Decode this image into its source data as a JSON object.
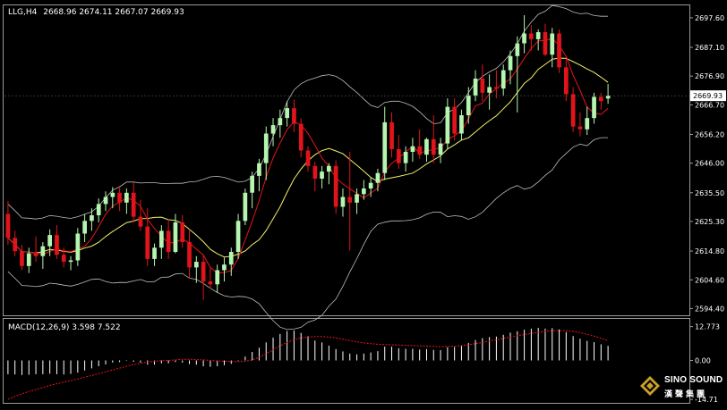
{
  "header": {
    "symbol": "LLG,H4",
    "ohlc": "2668.96 2674.11 2667.07 2669.93"
  },
  "price_axis": {
    "ticks": [
      2697.6,
      2687.1,
      2676.9,
      2666.7,
      2656.2,
      2646.0,
      2635.5,
      2625.3,
      2614.8,
      2604.6,
      2594.4
    ],
    "tick_labels": [
      "2697.60",
      "2687.10",
      "2676.90",
      "2666.70",
      "2656.20",
      "2646.00",
      "2635.50",
      "2625.30",
      "2614.80",
      "2604.60",
      "2594.40"
    ],
    "current_price": "2669.93"
  },
  "macd_panel": {
    "label": "MACD(12,26,9) 3.598 7.522",
    "tick_labels": [
      "12.773",
      "0.00",
      "-14.71"
    ],
    "ticks": [
      12.773,
      0,
      -14.71
    ]
  },
  "logo": {
    "brand": "SINO SOUND",
    "chinese": "漢聲集團"
  },
  "colors": {
    "background": "#000000",
    "bull_candle": "#b5f5b0",
    "bear_candle": "#e0141a",
    "ma_fast": "#e8141a",
    "ma_slow": "#f2ef6a",
    "bollinger": "#bdbdbd",
    "macd_hist": "#ffffff",
    "macd_signal": "#e8141a",
    "axis_text": "#ffffff"
  },
  "chart_data": {
    "type": "candlestick",
    "timeframe": "H4",
    "ylim": [
      2592.0,
      2702.0
    ],
    "candles": [
      [
        2628.0,
        2632.5,
        2617.0,
        2619.5
      ],
      [
        2619.5,
        2622.0,
        2613.0,
        2614.8
      ],
      [
        2614.8,
        2617.0,
        2608.0,
        2609.5
      ],
      [
        2609.5,
        2616.0,
        2607.0,
        2614.0
      ],
      [
        2614.0,
        2620.0,
        2611.0,
        2613.0
      ],
      [
        2613.0,
        2618.0,
        2608.5,
        2616.5
      ],
      [
        2616.5,
        2622.5,
        2613.0,
        2620.5
      ],
      [
        2620.5,
        2624.0,
        2612.0,
        2613.5
      ],
      [
        2613.5,
        2616.0,
        2609.0,
        2611.0
      ],
      [
        2611.0,
        2613.0,
        2608.0,
        2611.5
      ],
      [
        2611.5,
        2623.0,
        2609.5,
        2621.0
      ],
      [
        2621.0,
        2628.0,
        2618.0,
        2625.5
      ],
      [
        2625.5,
        2630.0,
        2622.0,
        2627.5
      ],
      [
        2627.5,
        2633.5,
        2625.0,
        2631.5
      ],
      [
        2631.5,
        2636.0,
        2629.0,
        2634.0
      ],
      [
        2634.0,
        2637.5,
        2630.0,
        2635.5
      ],
      [
        2635.5,
        2638.0,
        2629.0,
        2632.0
      ],
      [
        2632.0,
        2637.0,
        2628.0,
        2635.5
      ],
      [
        2635.5,
        2639.0,
        2625.0,
        2627.0
      ],
      [
        2627.0,
        2633.0,
        2622.0,
        2623.5
      ],
      [
        2623.5,
        2630.0,
        2609.5,
        2612.0
      ],
      [
        2612.0,
        2617.5,
        2609.5,
        2616.0
      ],
      [
        2616.0,
        2624.0,
        2612.0,
        2622.0
      ],
      [
        2622.0,
        2626.0,
        2612.0,
        2614.5
      ],
      [
        2614.5,
        2628.0,
        2614.0,
        2625.0
      ],
      [
        2625.0,
        2627.5,
        2616.0,
        2618.0
      ],
      [
        2618.0,
        2622.5,
        2605.0,
        2609.0
      ],
      [
        2609.0,
        2613.0,
        2603.5,
        2611.0
      ],
      [
        2611.0,
        2613.5,
        2597.5,
        2604.0
      ],
      [
        2604.0,
        2609.0,
        2601.5,
        2603.0
      ],
      [
        2603.0,
        2610.0,
        2600.0,
        2608.0
      ],
      [
        2608.0,
        2612.5,
        2604.0,
        2610.0
      ],
      [
        2610.0,
        2616.0,
        2606.0,
        2614.5
      ],
      [
        2614.5,
        2628.0,
        2612.0,
        2625.5
      ],
      [
        2625.5,
        2637.0,
        2624.0,
        2635.5
      ],
      [
        2635.5,
        2643.0,
        2630.0,
        2641.5
      ],
      [
        2641.5,
        2647.5,
        2636.0,
        2646.0
      ],
      [
        2646.0,
        2659.0,
        2640.0,
        2656.5
      ],
      [
        2656.5,
        2662.0,
        2652.0,
        2659.5
      ],
      [
        2659.5,
        2665.0,
        2655.0,
        2662.0
      ],
      [
        2662.0,
        2668.0,
        2659.0,
        2665.5
      ],
      [
        2665.5,
        2668.5,
        2657.0,
        2660.0
      ],
      [
        2660.0,
        2662.0,
        2648.0,
        2650.5
      ],
      [
        2650.5,
        2652.0,
        2643.0,
        2645.0
      ],
      [
        2645.0,
        2646.5,
        2636.0,
        2640.5
      ],
      [
        2640.5,
        2645.0,
        2637.0,
        2643.0
      ],
      [
        2643.0,
        2646.0,
        2638.5,
        2645.0
      ],
      [
        2645.0,
        2647.0,
        2628.0,
        2630.5
      ],
      [
        2630.5,
        2637.0,
        2627.0,
        2634.0
      ],
      [
        2634.0,
        2650.0,
        2615.0,
        2632.0
      ],
      [
        2632.0,
        2637.0,
        2628.0,
        2635.0
      ],
      [
        2635.0,
        2640.0,
        2633.0,
        2637.0
      ],
      [
        2637.0,
        2641.0,
        2634.0,
        2639.0
      ],
      [
        2639.0,
        2644.0,
        2636.0,
        2642.5
      ],
      [
        2642.5,
        2666.0,
        2640.0,
        2660.5
      ],
      [
        2660.5,
        2664.0,
        2648.0,
        2651.0
      ],
      [
        2651.0,
        2656.0,
        2644.0,
        2646.0
      ],
      [
        2646.0,
        2652.0,
        2643.0,
        2650.0
      ],
      [
        2650.0,
        2655.0,
        2646.5,
        2652.0
      ],
      [
        2652.0,
        2658.0,
        2647.5,
        2649.0
      ],
      [
        2649.0,
        2655.0,
        2646.5,
        2654.5
      ],
      [
        2654.5,
        2663.0,
        2646.0,
        2649.0
      ],
      [
        2649.0,
        2655.0,
        2646.0,
        2653.0
      ],
      [
        2653.0,
        2669.0,
        2651.0,
        2666.0
      ],
      [
        2666.0,
        2669.0,
        2654.0,
        2656.5
      ],
      [
        2656.5,
        2665.0,
        2654.0,
        2663.0
      ],
      [
        2663.0,
        2673.0,
        2660.0,
        2670.0
      ],
      [
        2670.0,
        2679.0,
        2668.0,
        2676.0
      ],
      [
        2676.0,
        2681.0,
        2668.0,
        2671.0
      ],
      [
        2671.0,
        2677.5,
        2665.0,
        2673.0
      ],
      [
        2673.0,
        2679.0,
        2669.0,
        2672.5
      ],
      [
        2672.5,
        2681.0,
        2670.0,
        2679.0
      ],
      [
        2679.0,
        2686.0,
        2674.0,
        2684.0
      ],
      [
        2684.0,
        2691.0,
        2664.0,
        2688.5
      ],
      [
        2688.5,
        2698.5,
        2685.0,
        2692.0
      ],
      [
        2692.0,
        2695.0,
        2686.0,
        2690.0
      ],
      [
        2690.0,
        2693.5,
        2686.0,
        2692.5
      ],
      [
        2692.5,
        2695.5,
        2684.0,
        2684.5
      ],
      [
        2684.5,
        2694.0,
        2680.0,
        2692.0
      ],
      [
        2692.0,
        2693.5,
        2678.0,
        2680.0
      ],
      [
        2680.0,
        2683.0,
        2668.0,
        2670.5
      ],
      [
        2670.5,
        2673.0,
        2657.0,
        2659.0
      ],
      [
        2659.0,
        2664.0,
        2655.5,
        2658.0
      ],
      [
        2658.0,
        2666.0,
        2656.0,
        2662.0
      ],
      [
        2662.0,
        2671.0,
        2660.0,
        2669.5
      ],
      [
        2669.5,
        2671.0,
        2665.0,
        2668.0
      ],
      [
        2668.96,
        2674.11,
        2667.07,
        2669.93
      ]
    ],
    "macd_histogram": [
      -5.2,
      -5.3,
      -5.5,
      -5.4,
      -5.2,
      -5.2,
      -5.0,
      -5.2,
      -5.3,
      -5.1,
      -4.6,
      -3.8,
      -3.0,
      -2.2,
      -1.5,
      -0.8,
      -0.6,
      -0.2,
      -0.5,
      -0.8,
      -1.6,
      -1.6,
      -1.1,
      -1.1,
      -0.6,
      -0.8,
      -1.4,
      -1.6,
      -2.2,
      -2.4,
      -2.2,
      -1.8,
      -1.3,
      -0.2,
      1.5,
      3.2,
      4.8,
      6.8,
      8.6,
      10.0,
      11.1,
      11.3,
      10.4,
      9.2,
      7.5,
      6.8,
      5.6,
      4.3,
      3.4,
      2.6,
      2.3,
      2.6,
      3.0,
      3.5,
      5.2,
      5.2,
      4.6,
      4.4,
      4.4,
      4.1,
      4.3,
      4.0,
      3.9,
      5.0,
      5.1,
      5.6,
      6.6,
      7.7,
      8.4,
      8.8,
      9.0,
      9.7,
      10.5,
      11.0,
      11.6,
      12.0,
      12.3,
      12.0,
      12.2,
      11.7,
      10.7,
      9.2,
      8.2,
      7.4,
      6.9,
      6.1,
      5.5
    ],
    "macd_signal": [
      -14.7,
      -13.6,
      -12.6,
      -11.7,
      -11.0,
      -10.2,
      -9.4,
      -8.8,
      -8.2,
      -7.6,
      -7.0,
      -6.3,
      -5.7,
      -5.0,
      -4.3,
      -3.6,
      -2.9,
      -2.2,
      -1.6,
      -1.1,
      -0.6,
      -0.3,
      -0.1,
      0.0,
      0.2,
      0.4,
      0.4,
      0.3,
      0.2,
      0.0,
      -0.2,
      -0.3,
      -0.4,
      -0.5,
      -0.3,
      0.2,
      1.2,
      2.5,
      4.0,
      5.5,
      6.8,
      7.8,
      8.5,
      8.8,
      9.0,
      9.0,
      8.8,
      8.5,
      8.0,
      7.5,
      7.0,
      6.6,
      6.3,
      6.1,
      6.0,
      5.9,
      5.8,
      5.7,
      5.6,
      5.5,
      5.4,
      5.3,
      5.2,
      5.3,
      5.4,
      5.6,
      5.9,
      6.3,
      6.8,
      7.3,
      7.8,
      8.3,
      8.8,
      9.3,
      9.8,
      10.2,
      10.6,
      11.0,
      11.2,
      11.3,
      11.2,
      11.0,
      10.5,
      9.9,
      9.2,
      8.4,
      7.5
    ],
    "macd_ylim": [
      -15.0,
      14.0
    ]
  }
}
